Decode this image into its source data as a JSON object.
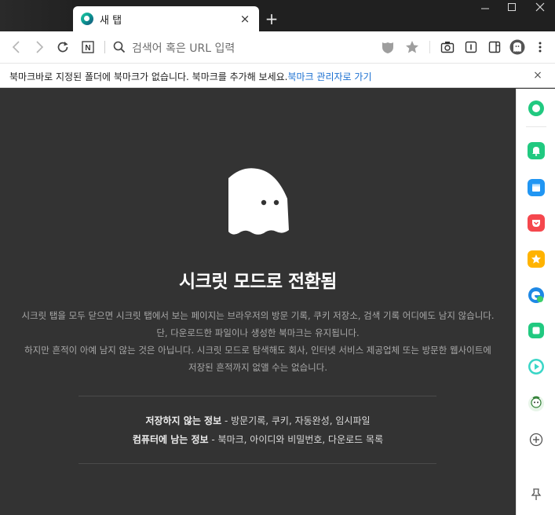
{
  "tab": {
    "title": "새 탭",
    "close": "×"
  },
  "newtab": "+",
  "window_controls": {
    "minimize": "—",
    "maximize": "☐",
    "close": "✕"
  },
  "toolbar": {
    "omnibox_placeholder": "검색어 혹은 URL 입력",
    "naver_label": "N"
  },
  "bookmarkbar": {
    "message": "북마크바로 지정된 폴더에 북마크가 없습니다. 북마크를 추가해 보세요.",
    "link": "북마크 관리자로 가기",
    "close": "×"
  },
  "content": {
    "heading": "시크릿 모드로 전환됨",
    "desc_line1": "시크릿 탭을 모두 닫으면 시크릿 탭에서 보는 페이지는 브라우저의 방문 기록, 쿠키 저장소, 검색 기록 어디에도 남지 않습니다.",
    "desc_line2": "단, 다운로드한 파일이나 생성한 북마크는 유지됩니다.",
    "desc_line3": "하지만 흔적이 아예 남지 않는 것은 아닙니다. 시크릿 모드로 탐색해도 회사, 인터넷 서비스 제공업체 또는 방문한 웹사이트에",
    "desc_line4": "저장된 흔적까지 없앨 수는 없습니다.",
    "not_saved_label": "저장하지 않는 정보",
    "not_saved_value": " - 방문기록, 쿠키, 자동완성, 임시파일",
    "saved_label": "컴퓨터에 남는 정보",
    "saved_value": " - 북마크, 아이디와 비밀번호, 다운로드 목록"
  },
  "colors": {
    "content_bg": "#333333",
    "link": "#1a6fd1",
    "sidebar_green": "#21c980",
    "sidebar_blue": "#2196f3",
    "sidebar_red": "#f5474d",
    "sidebar_yellow": "#ffb300"
  },
  "sidebar": {
    "add": "+"
  }
}
